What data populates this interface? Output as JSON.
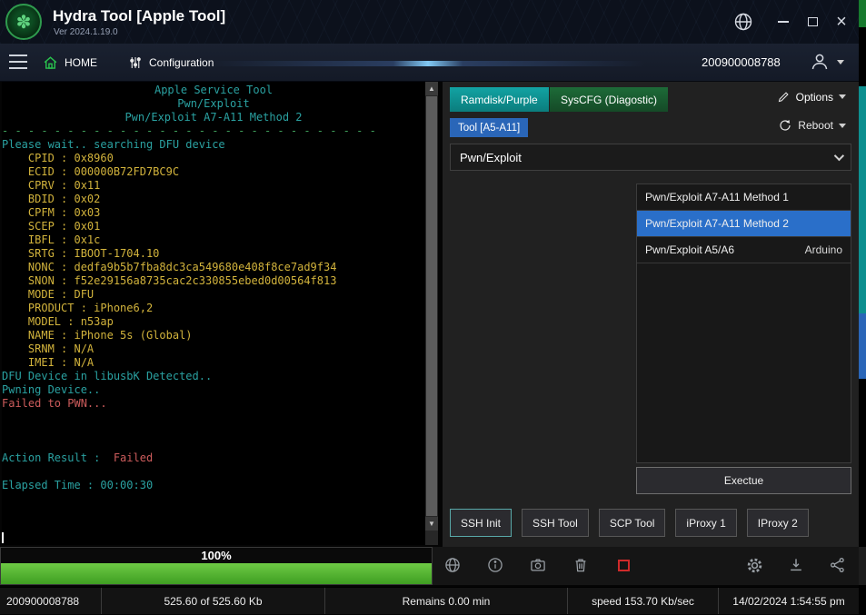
{
  "window": {
    "title": "Hydra Tool [Apple Tool]",
    "version": "Ver 2024.1.19.0"
  },
  "toolbar": {
    "home": "HOME",
    "configuration": "Configuration",
    "serial": "200900008788"
  },
  "console": {
    "header_lines": [
      "Apple Service Tool",
      "Pwn/Exploit",
      "Pwn/Exploit A7-A11 Method 2"
    ],
    "separator": "- - - - - - - - - - - - - - - - - - - - - - - - - - - - -",
    "searching_line": "Please wait.. searching DFU device",
    "info_lines": [
      "    CPID : 0x8960",
      "    ECID : 000000B72FD7BC9C",
      "    CPRV : 0x11",
      "    BDID : 0x02",
      "    CPFM : 0x03",
      "    SCEP : 0x01",
      "    IBFL : 0x1c",
      "    SRTG : IBOOT-1704.10",
      "    NONC : dedfa9b5b7fba8dc3ca549680e408f8ce7ad9f34",
      "    SNON : f52e29156a8735cac2c330855ebed0d00564f813",
      "    MODE : DFU",
      "    PRODUCT : iPhone6,2",
      "    MODEL : n53ap",
      "    NAME : iPhone 5s (Global)",
      "    SRNM : N/A",
      "    IMEI : N/A"
    ],
    "status_lines": [
      "DFU Device in libusbK Detected..",
      "Pwning Device.."
    ],
    "failed_line": "Failed to PWN...",
    "action_result_label": "Action Result :  ",
    "action_result_value": "Failed",
    "elapsed_line": "Elapsed Time : 00:00:30"
  },
  "right_panel": {
    "tab_ramdisk": "Ramdisk/Purple",
    "tab_syscfg": "SysCFG (Diagostic)",
    "options": "Options",
    "tool_tab": "Tool [A5-A11]",
    "reboot": "Reboot",
    "exploit_select_value": "Pwn/Exploit",
    "methods": [
      {
        "label": "Pwn/Exploit A7-A11 Method 1",
        "note": ""
      },
      {
        "label": "Pwn/Exploit A7-A11 Method 2",
        "note": ""
      },
      {
        "label": "Pwn/Exploit A5/A6",
        "note": "Arduino"
      }
    ],
    "execute": "Exectue",
    "tool_buttons": [
      "SSH Init",
      "SSH Tool",
      "SCP Tool",
      "iProxy 1",
      "IProxy 2"
    ]
  },
  "progress": {
    "label": "100%",
    "value": 100
  },
  "status_bar": {
    "serial": "200900008788",
    "transferred": "525.60 of 525.60 Kb",
    "remains": "Remains 0.00 min",
    "speed": "speed 153.70 Kb/sec",
    "datetime": "14/02/2024 1:54:55 pm"
  },
  "colors": {
    "console_teal": "#2aa1a1",
    "console_yellow": "#d2b33c",
    "console_red": "#cd5c5c",
    "console_green": "#3f9e5a",
    "selection_blue": "#2a6fc9",
    "tab_teal": "#0e9a9a",
    "tab_green": "#1b5c31",
    "progress_green": "#4fb32b"
  }
}
